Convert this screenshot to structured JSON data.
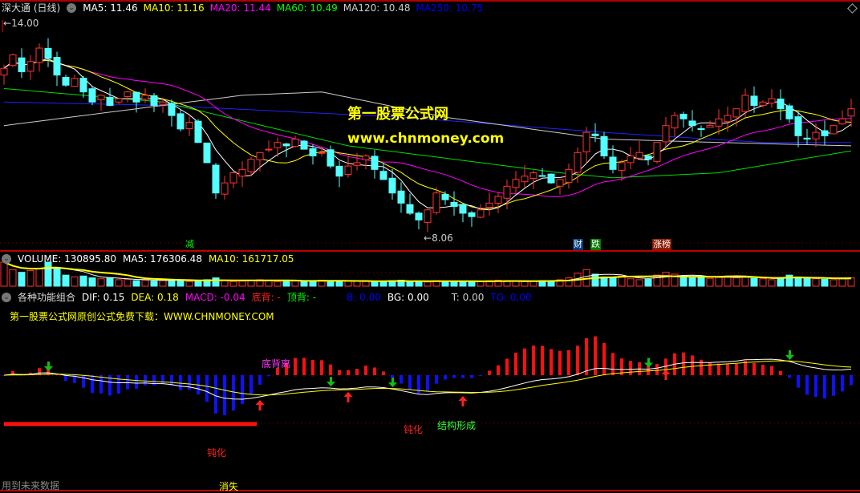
{
  "price_panel": {
    "stock_name": "深大通",
    "period": "(日线)",
    "ma_labels": [
      {
        "text": "MA5: 11.46",
        "color": "#ffffff"
      },
      {
        "text": "MA10: 11.16",
        "color": "#ffff00"
      },
      {
        "text": "MA20: 11.44",
        "color": "#ff00ff"
      },
      {
        "text": "MA60: 10.49",
        "color": "#00ff00"
      },
      {
        "text": "MA120: 10.48",
        "color": "#cccccc"
      },
      {
        "text": "MA250: 10.75",
        "color": "#0000ff"
      }
    ],
    "high_label": "14.00",
    "low_label": "8.06",
    "watermark_title": "第一股票公式网",
    "watermark_url": "www.chnmoney.com",
    "tags": [
      {
        "text": "减",
        "index": 21,
        "bg": "#000000",
        "color": "#00ff00"
      },
      {
        "text": "财",
        "index": 65,
        "bg": "#003a78",
        "color": "#ffffff"
      },
      {
        "text": "跌",
        "index": 67,
        "bg": "#007a00",
        "color": "#ffffff"
      },
      {
        "text": "涨榜",
        "index": 74,
        "bg": "#8a1a00",
        "color": "#ffffff"
      }
    ]
  },
  "volume_panel": {
    "volume_label": "VOLUME: 130895.80",
    "ma5_label": "MA5: 176306.48",
    "ma10_label": "MA10: 161717.05"
  },
  "macd_panel": {
    "title": "各种功能组合",
    "dif_label": "DIF: 0.15",
    "dea_label": "DEA: 0.18",
    "macd_label": "MACD: -0.04",
    "bottom_div_label": "底背: -",
    "top_div_label": "顶背: -",
    "b_label": "B: 0.00",
    "bg_label": "BG: 0.00",
    "t_label": "T: 0.00",
    "tg_label": "TG: 0.00",
    "promo_text": "第一股票公式网原创公式免费下载：WWW.CHNMONEY.COM",
    "annotations": {
      "bottom_divergence": "底背离",
      "blunt_1": "钝化",
      "vanish": "消失",
      "blunt_2": "钝化",
      "structure_formed": "结构形成"
    },
    "down_arrows": [
      5,
      37,
      44,
      73,
      89
    ],
    "up_arrows": [
      29,
      39,
      52,
      75
    ]
  },
  "footer": {
    "future_data_text": "用到未来数据"
  },
  "chart_data": {
    "type": "candlestick",
    "ylim": [
      7.7,
      14.6
    ],
    "close": [
      13.0,
      13.4,
      12.9,
      13.2,
      13.6,
      13.3,
      12.8,
      12.5,
      12.7,
      12.3,
      12.0,
      12.2,
      11.9,
      12.1,
      12.3,
      12.0,
      12.2,
      11.9,
      12.0,
      11.6,
      11.2,
      11.4,
      10.8,
      10.2,
      9.3,
      9.6,
      9.9,
      10.0,
      10.3,
      10.5,
      10.6,
      10.8,
      10.7,
      10.9,
      10.6,
      10.4,
      10.5,
      10.1,
      9.8,
      10.1,
      10.2,
      10.4,
      10.0,
      9.7,
      9.3,
      9.0,
      8.7,
      8.5,
      8.8,
      9.3,
      9.1,
      8.9,
      8.7,
      8.6,
      8.8,
      9.0,
      9.2,
      9.5,
      9.7,
      9.8,
      9.9,
      9.8,
      9.6,
      9.7,
      10.0,
      10.5,
      11.1,
      11.0,
      10.4,
      10.0,
      10.2,
      10.4,
      10.5,
      10.3,
      10.8,
      11.3,
      11.6,
      11.5,
      11.3,
      11.2,
      11.3,
      11.5,
      11.6,
      11.8,
      12.2,
      11.9,
      12.0,
      12.1,
      11.8,
      11.5,
      11.0,
      10.9,
      11.1,
      11.0,
      11.3,
      11.5,
      11.8
    ],
    "volume": [
      260,
      180,
      150,
      170,
      190,
      260,
      200,
      120,
      100,
      110,
      90,
      80,
      85,
      70,
      75,
      60,
      65,
      55,
      60,
      70,
      65,
      50,
      55,
      70,
      90,
      60,
      50,
      55,
      60,
      70,
      65,
      50,
      60,
      55,
      50,
      60,
      65,
      55,
      50,
      60,
      55,
      50,
      45,
      55,
      60,
      65,
      55,
      50,
      45,
      60,
      55,
      50,
      45,
      50,
      55,
      60,
      65,
      60,
      55,
      50,
      55,
      60,
      50,
      70,
      90,
      140,
      180,
      130,
      100,
      90,
      110,
      80,
      70,
      75,
      120,
      150,
      130,
      110,
      90,
      100,
      85,
      95,
      110,
      90,
      100,
      85,
      80,
      70,
      90,
      120,
      100,
      85,
      80,
      75,
      70,
      85,
      90
    ],
    "ma60": [
      [
        0,
        12.4
      ],
      [
        18,
        12.0
      ],
      [
        39,
        10.7
      ],
      [
        63,
        9.9
      ],
      [
        69,
        9.75
      ],
      [
        81,
        9.9
      ],
      [
        96,
        10.55
      ]
    ],
    "ma120": [
      [
        0,
        11.3
      ],
      [
        27,
        12.2
      ],
      [
        36,
        12.3
      ],
      [
        50,
        11.55
      ],
      [
        68,
        10.9
      ],
      [
        81,
        10.8
      ],
      [
        96,
        10.7
      ]
    ],
    "ma250": [
      [
        0,
        12.0
      ],
      [
        18,
        11.9
      ],
      [
        45,
        11.55
      ],
      [
        68,
        11.1
      ],
      [
        86,
        10.8
      ],
      [
        96,
        10.8
      ]
    ]
  }
}
